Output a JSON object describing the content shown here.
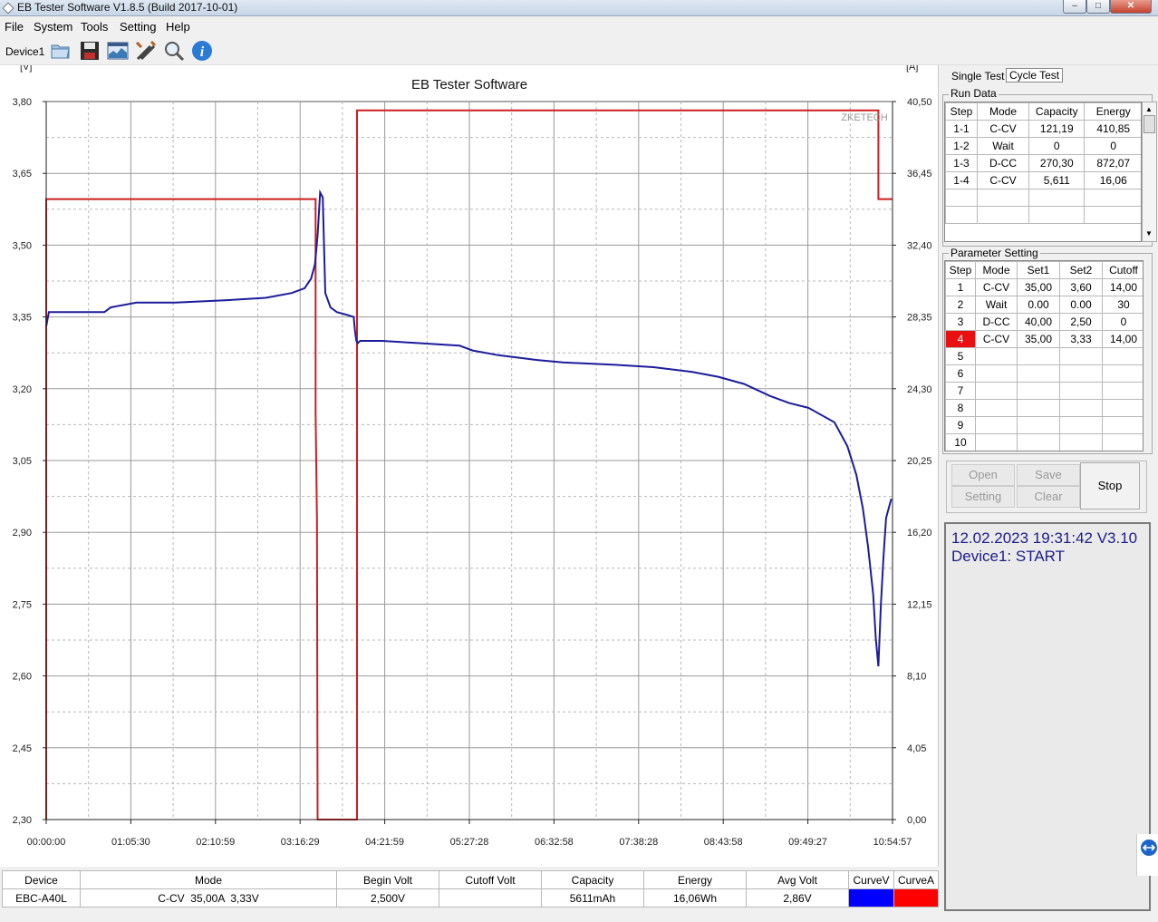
{
  "window": {
    "title": "EB Tester Software V1.8.5 (Build 2017-10-01)",
    "min_label": "‒",
    "max_label": "□",
    "close_label": "✕"
  },
  "menu": [
    "File",
    "System",
    "Tools",
    "Setting",
    "Help"
  ],
  "toolbar": {
    "device_label": "Device1",
    "icons": [
      "open-folder-icon",
      "save-disk-icon",
      "chart-image-icon",
      "tools-icon",
      "search-icon",
      "info-icon"
    ]
  },
  "chart_data": {
    "type": "line",
    "title": "EB Tester Software",
    "watermark": "ZKETECH",
    "ylabel_left": "[V]",
    "ylabel_right": "[A]",
    "ylim_left": [
      2.3,
      3.8
    ],
    "ylim_right": [
      0.0,
      40.5
    ],
    "left_ticks": [
      "3,80",
      "3,65",
      "3,50",
      "3,35",
      "3,20",
      "3,05",
      "2,90",
      "2,75",
      "2,60",
      "2,45",
      "2,30"
    ],
    "right_ticks": [
      "40,50",
      "36,45",
      "32,40",
      "28,35",
      "24,30",
      "20,25",
      "16,20",
      "12,15",
      "8,10",
      "4,05",
      "0,00"
    ],
    "x_ticks": [
      "00:00:00",
      "01:05:30",
      "02:10:59",
      "03:16:29",
      "04:21:59",
      "05:27:28",
      "06:32:58",
      "07:38:28",
      "08:43:58",
      "09:49:27",
      "10:54:57"
    ],
    "x_range_minutes": [
      0,
      654.95
    ],
    "grid": true,
    "series": [
      {
        "name": "CurveV",
        "color": "#1c1c9c",
        "x": [
          0,
          2,
          30,
          45,
          50,
          70,
          100,
          140,
          170,
          190,
          200,
          205,
          208,
          210,
          212,
          214,
          216,
          220,
          225,
          232,
          238,
          239,
          240,
          241,
          243,
          260,
          290,
          320,
          330,
          350,
          380,
          400,
          440,
          470,
          500,
          520,
          540,
          560,
          575,
          590,
          610,
          620,
          627,
          632,
          636,
          640,
          642,
          644,
          646,
          648,
          650,
          654
        ],
        "values": [
          3.33,
          3.36,
          3.36,
          3.36,
          3.37,
          3.38,
          3.38,
          3.385,
          3.39,
          3.4,
          3.41,
          3.43,
          3.46,
          3.52,
          3.61,
          3.6,
          3.4,
          3.37,
          3.36,
          3.355,
          3.35,
          3.32,
          3.3,
          3.295,
          3.3,
          3.3,
          3.295,
          3.29,
          3.28,
          3.27,
          3.26,
          3.255,
          3.25,
          3.245,
          3.235,
          3.225,
          3.21,
          3.185,
          3.17,
          3.16,
          3.13,
          3.08,
          3.02,
          2.95,
          2.87,
          2.77,
          2.68,
          2.62,
          2.75,
          2.85,
          2.93,
          2.97
        ]
      },
      {
        "name": "CurveA",
        "color": "#cc1e1e",
        "x": [
          0,
          0,
          208.5,
          208.5,
          209.5,
          210,
          210,
          240.5,
          240.5,
          644,
          644,
          654.95
        ],
        "values": [
          0,
          35.0,
          35.0,
          23.0,
          17.0,
          0,
          0,
          0,
          40.0,
          40.0,
          35.0,
          35.0
        ]
      }
    ]
  },
  "right": {
    "tab_single": "Single Test",
    "tab_cycle": "Cycle Test",
    "run_data_label": "Run Data",
    "run_headers": [
      "Step",
      "Mode",
      "Capacity",
      "Energy"
    ],
    "run_rows": [
      [
        "1-1",
        "C-CV",
        "121,19",
        "410,85"
      ],
      [
        "1-2",
        "Wait",
        "0",
        "0"
      ],
      [
        "1-3",
        "D-CC",
        "270,30",
        "872,07"
      ],
      [
        "1-4",
        "C-CV",
        "5,611",
        "16,06"
      ],
      [
        "",
        "",
        "",
        ""
      ],
      [
        "",
        "",
        "",
        ""
      ]
    ],
    "param_label": "Parameter Setting",
    "param_headers": [
      "Step",
      "Mode",
      "Set1",
      "Set2",
      "Cutoff"
    ],
    "param_rows": [
      [
        "1",
        "C-CV",
        "35,00",
        "3,60",
        "14,00"
      ],
      [
        "2",
        "Wait",
        "0.00",
        "0.00",
        "30"
      ],
      [
        "3",
        "D-CC",
        "40,00",
        "2,50",
        "0"
      ],
      [
        "4",
        "C-CV",
        "35,00",
        "3,33",
        "14,00"
      ],
      [
        "5",
        "",
        "",
        "",
        ""
      ],
      [
        "6",
        "",
        "",
        "",
        ""
      ],
      [
        "7",
        "",
        "",
        "",
        ""
      ],
      [
        "8",
        "",
        "",
        "",
        ""
      ],
      [
        "9",
        "",
        "",
        "",
        ""
      ],
      [
        "10",
        "",
        "",
        "",
        ""
      ]
    ],
    "active_step_color": "#e81010",
    "buttons": {
      "open": "Open",
      "save": "Save",
      "setting": "Setting",
      "clear": "Clear",
      "stop": "Stop"
    },
    "log": [
      "12.02.2023 19:31:42  V3.10",
      "Device1: START"
    ]
  },
  "bottom": {
    "headers": [
      "Device",
      "Mode",
      "Begin Volt",
      "Cutoff Volt",
      "Capacity",
      "Energy",
      "Avg Volt",
      "CurveV",
      "CurveA"
    ],
    "row": [
      "EBC-A40L",
      "C-CV  35,00A  3,33V",
      "2,500V",
      "",
      "5611mAh",
      "16,06Wh",
      "2,86V"
    ],
    "curve_v_color": "#0000ff",
    "curve_a_color": "#ff0000"
  }
}
